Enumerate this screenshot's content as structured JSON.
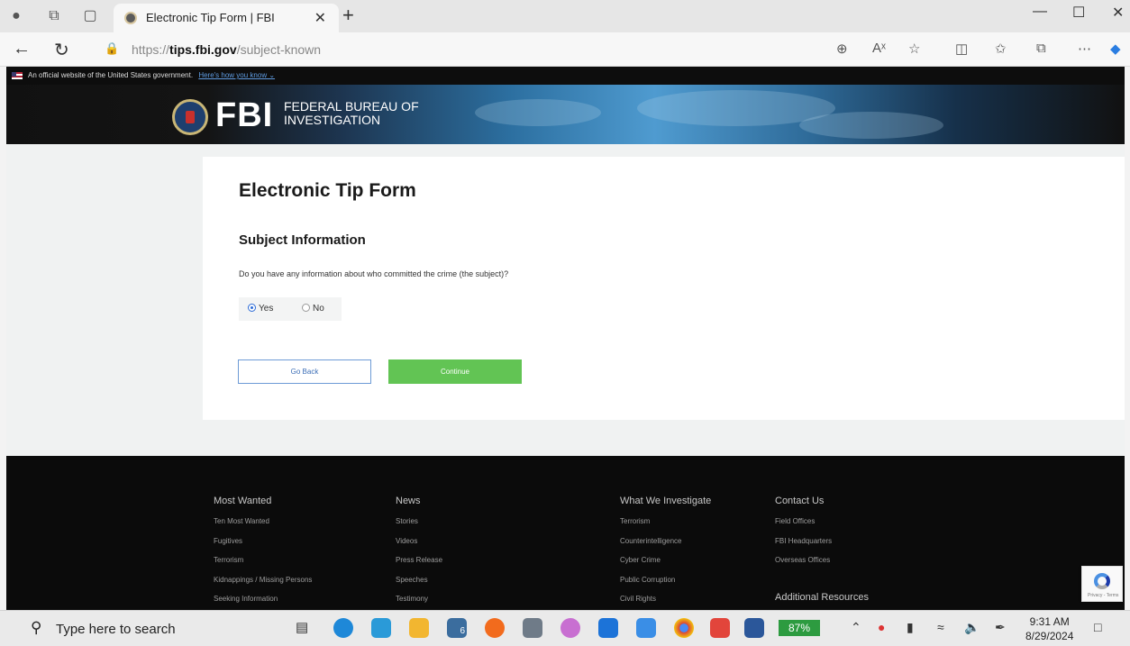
{
  "browser": {
    "tab_title": "Electronic Tip Form | FBI",
    "tab_close": "✕",
    "new_tab": "+",
    "url_host": "https://tips.fbi.gov",
    "url_path": "/subject-known",
    "url_host_prefix": "https://",
    "url_host_bold": "tips.fbi.gov",
    "icons": [
      "profile-icon",
      "workspaces-icon",
      "tab-actions-icon",
      "back-icon",
      "refresh-icon",
      "site-info-icon",
      "zoom-icon",
      "read-aloud-icon",
      "favorite-icon",
      "split-screen-icon",
      "favorites-icon",
      "collections-icon",
      "more-icon",
      "copilot-icon"
    ]
  },
  "header": {
    "gov_banner": "An official website of the United States government.",
    "gov_link": "Here's how you know ⌄",
    "logo_text": "FBI",
    "org_line1": "FEDERAL BUREAU OF",
    "org_line2": "INVESTIGATION"
  },
  "form": {
    "title": "Electronic Tip Form",
    "section": "Subject Information",
    "question": "Do you have any information about who committed the crime (the subject)?",
    "options": [
      {
        "label": "Yes",
        "selected": true
      },
      {
        "label": "No",
        "selected": false
      }
    ],
    "back_label": "Go Back",
    "continue_label": "Continue"
  },
  "footer": {
    "columns": [
      {
        "heading": "Most Wanted",
        "links": [
          "Ten Most Wanted",
          "Fugitives",
          "Terrorism",
          "Kidnappings / Missing Persons",
          "Seeking Information"
        ]
      },
      {
        "heading": "News",
        "links": [
          "Stories",
          "Videos",
          "Press Release",
          "Speeches",
          "Testimony"
        ]
      },
      {
        "heading": "What We Investigate",
        "links": [
          "Terrorism",
          "Counterintelligence",
          "Cyber Crime",
          "Public Corruption",
          "Civil Rights"
        ]
      },
      {
        "heading": "Contact Us",
        "links": [
          "Field Offices",
          "FBI Headquarters",
          "Overseas Offices"
        ],
        "extra_heading": "Additional Resources"
      }
    ],
    "recaptcha_text": "Privacy - Terms"
  },
  "taskbar": {
    "search_placeholder": "Type here to search",
    "battery": "87%",
    "time": "9:31 AM",
    "date": "8/29/2024",
    "badge": "6"
  },
  "colors": {
    "continue_green": "#62c454",
    "back_border_blue": "#6d9bd6",
    "footer_black": "#0b0b0b"
  }
}
